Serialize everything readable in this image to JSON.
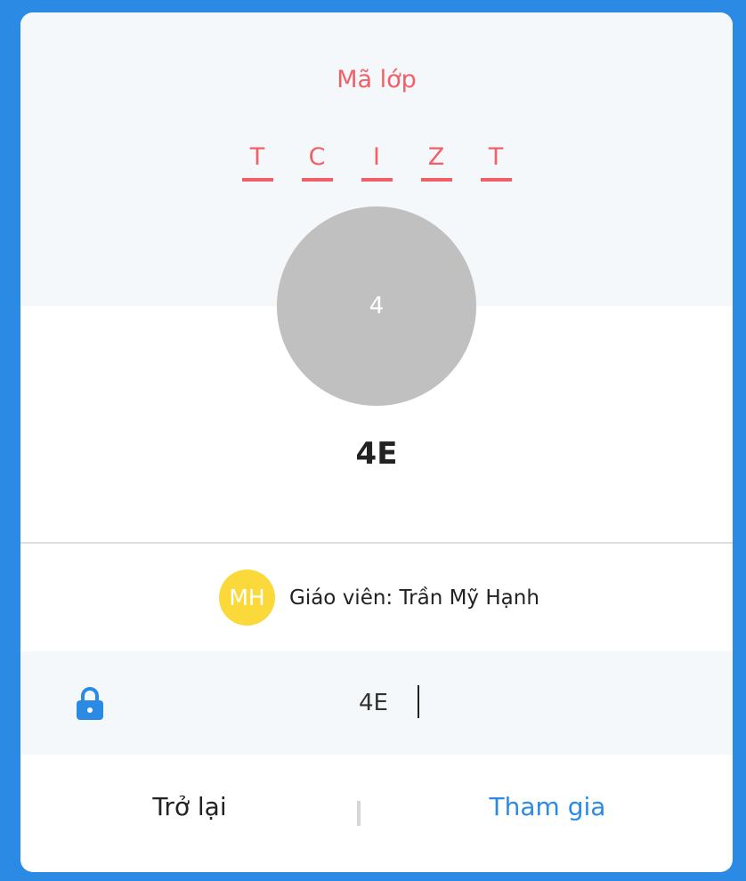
{
  "header": {
    "title": "Mã lớp",
    "code_chars": [
      "T",
      "C",
      "I",
      "Z",
      "T"
    ]
  },
  "class": {
    "avatar_text": "4",
    "name": "4E"
  },
  "teacher": {
    "initials": "MH",
    "label": "Giáo viên: Trần Mỹ Hạnh"
  },
  "password": {
    "value": "4E",
    "icon": "lock-icon"
  },
  "actions": {
    "back_label": "Trở lại",
    "join_label": "Tham gia"
  },
  "colors": {
    "background": "#2b8be4",
    "code_accent": "#f25f66",
    "join_accent": "#2b8be4",
    "teacher_avatar": "#fbd93b",
    "class_avatar": "#c0c0c0"
  }
}
